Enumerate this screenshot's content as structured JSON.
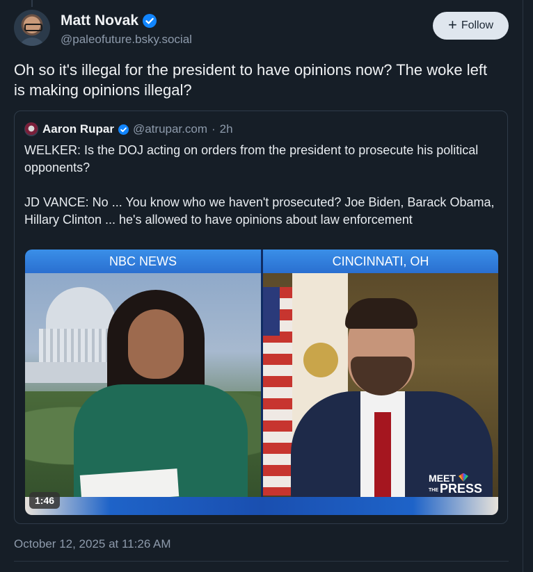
{
  "post": {
    "author_name": "Matt Novak",
    "author_handle": "@paleofuture.bsky.social",
    "follow_label": "Follow",
    "text": "Oh so it's illegal for the president to have opinions now? The woke left is making opinions illegal?",
    "timestamp": "October 12, 2025 at 11:26 AM"
  },
  "quote": {
    "author_name": "Aaron Rupar",
    "author_handle": "@atrupar.com",
    "separator": "·",
    "age": "2h",
    "paragraph_1": "WELKER: Is the DOJ acting on orders from the president to prosecute his political opponents?",
    "paragraph_2": "JD VANCE: No ... You know who we haven't prosecuted? Joe Biden, Barack Obama, Hillary Clinton ... he's allowed to have opinions about law enforcement"
  },
  "video": {
    "left_label": "NBC NEWS",
    "right_label": "CINCINNATI, OH",
    "duration": "1:46",
    "logo_line1": "MEET",
    "logo_the": "THE",
    "logo_line2": "PRESS"
  },
  "colors": {
    "background": "#161e27",
    "verified_badge": "#1185fe",
    "secondary_text": "#8d9aab",
    "follow_button_bg": "#dfe6ee",
    "nbc_banner": "#3a8fe8"
  }
}
